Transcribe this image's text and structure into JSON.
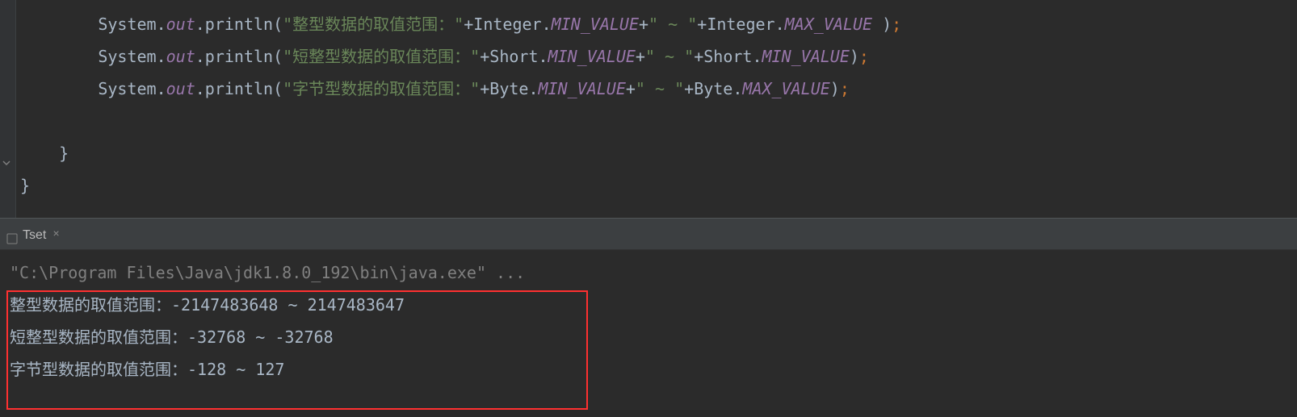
{
  "code": {
    "lines": [
      {
        "indent": "        ",
        "cls": "System",
        "dot1": ".",
        "out": "out",
        "dot2": ".",
        "method": "println",
        "open": "(",
        "str1": "\"整型数据的取值范围：\"",
        "plus1": "+",
        "cls2": "Integer",
        "dot3": ".",
        "const1": "MIN_VALUE",
        "plus2": "+",
        "str2": "\" ~ \"",
        "plus3": "+",
        "cls3": "Integer",
        "dot4": ".",
        "const2": "MAX_VALUE",
        "space": " ",
        "close": ")",
        "semi": ";"
      },
      {
        "indent": "        ",
        "cls": "System",
        "dot1": ".",
        "out": "out",
        "dot2": ".",
        "method": "println",
        "open": "(",
        "str1": "\"短整型数据的取值范围：\"",
        "plus1": "+",
        "cls2": "Short",
        "dot3": ".",
        "const1": "MIN_VALUE",
        "plus2": "+",
        "str2": "\" ~ \"",
        "plus3": "+",
        "cls3": "Short",
        "dot4": ".",
        "const2": "MIN_VALUE",
        "space": "",
        "close": ")",
        "semi": ";"
      },
      {
        "indent": "        ",
        "cls": "System",
        "dot1": ".",
        "out": "out",
        "dot2": ".",
        "method": "println",
        "open": "(",
        "str1": "\"字节型数据的取值范围：\"",
        "plus1": "+",
        "cls2": "Byte",
        "dot3": ".",
        "const1": "MIN_VALUE",
        "plus2": "+",
        "str2": "\" ~ \"",
        "plus3": "+",
        "cls3": "Byte",
        "dot4": ".",
        "const2": "MAX_VALUE",
        "space": "",
        "close": ")",
        "semi": ";"
      }
    ],
    "closing_braces": [
      "    }",
      "}"
    ]
  },
  "console": {
    "tab_label": "Tset",
    "tab_close": "×",
    "jdk_line": "\"C:\\Program Files\\Java\\jdk1.8.0_192\\bin\\java.exe\" ...",
    "out_lines": [
      "整型数据的取值范围：-2147483648 ~ 2147483647",
      "短整型数据的取值范围：-32768 ~ -32768",
      "字节型数据的取值范围：-128 ~ 127"
    ]
  }
}
